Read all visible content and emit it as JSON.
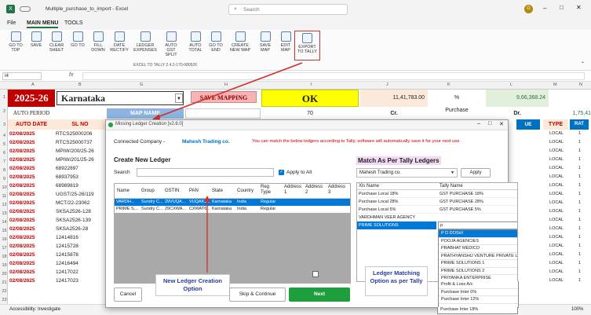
{
  "window": {
    "title": "Multiple_purchase_to_import",
    "app": "Excel",
    "search_placeholder": "Search",
    "user_initial": "G"
  },
  "ribbon_tabs": [
    "File",
    "MAIN MENU",
    "TOOLS"
  ],
  "ribbon_buttons": [
    "GO TO TOP",
    "SAVE",
    "CLEAR SHEET",
    "GO TO",
    "FILL DOWN",
    "DATE RECTIFY",
    "LEDGER EXPENSES",
    "AUTO GST SPLIT",
    "AUTO TOTAL",
    "GO TO END",
    "CREATE NEW MAP",
    "SAVE MAP",
    "EDIT MAP",
    "EXPORT TO TALLY"
  ],
  "ribbon_group_label": "EXCEL TO TALLY 2.4.2-170-080526",
  "name_box": "I4",
  "formula_fx": "fx",
  "columns": [
    "A",
    "B",
    "G",
    "H",
    "I",
    "J",
    "K",
    "L",
    "M",
    "N"
  ],
  "sheet": {
    "year": "2025-26",
    "state": "Karnataka",
    "save_mapping": "SAVE MAPPING",
    "status": "OK",
    "total1": "11,41,783.00",
    "percent": "%",
    "total2": "9,66,368.24",
    "auto_period": "AUTO PERIOD",
    "map_name": "MAP NAME",
    "seventy": "70",
    "cr": "Cr.",
    "purchase": "Purchase",
    "dr": "Dr.",
    "dr_total": "1,75,41",
    "hdr_date": "AUTO DATE",
    "hdr_slno": "SL NO",
    "hdr_type": "TYPE",
    "hdr_rate": "RAT",
    "hdr_value": "UE",
    "rows": [
      {
        "date": "02/08/2025",
        "sl": "RTCS25000206"
      },
      {
        "date": "02/08/2025",
        "sl": "RTCS25000737"
      },
      {
        "date": "02/08/2025",
        "sl": "MPIW/200/25-26"
      },
      {
        "date": "02/08/2025",
        "sl": "MPIW/201/25-26"
      },
      {
        "date": "02/08/2025",
        "sl": "68922897"
      },
      {
        "date": "02/08/2025",
        "sl": "68937953"
      },
      {
        "date": "02/08/2025",
        "sl": "68989819"
      },
      {
        "date": "02/08/2025",
        "sl": "UGST/25-26/119"
      },
      {
        "date": "02/08/2025",
        "sl": "MCT/22-23062"
      },
      {
        "date": "02/08/2025",
        "sl": "SKSA2526-128"
      },
      {
        "date": "02/08/2025",
        "sl": "SKSA2526-139"
      },
      {
        "date": "02/08/2025",
        "sl": "SKSA2526-28"
      },
      {
        "date": "02/08/2025",
        "sl": "12414816"
      },
      {
        "date": "02/08/2025",
        "sl": "12415728"
      },
      {
        "date": "02/08/2025",
        "sl": "12415878"
      },
      {
        "date": "02/08/2025",
        "sl": "12416494"
      },
      {
        "date": "02/08/2025",
        "sl": "12417022"
      },
      {
        "date": "02/08/2025",
        "sl": "12417023"
      }
    ],
    "local": "LOCAL",
    "one": "1"
  },
  "row_numbers": [
    "1",
    "2",
    "3",
    "4",
    "5",
    "6",
    "7",
    "8",
    "9",
    "10",
    "11",
    "12",
    "13",
    "14",
    "15",
    "16",
    "17",
    "18",
    "19",
    "20",
    "21",
    "22",
    "23"
  ],
  "dialog": {
    "title": "Missing Ledger Creation [v2.6.0]",
    "company_label": "Connected Company -",
    "company": "Mahesh Trading co.",
    "notice": "You can match the below ledgers according to Tally, software will automatically save it for your next use.",
    "create_title": "Create New Ledger",
    "search_label": "Search",
    "apply_all": "Apply to All",
    "grid_headers": [
      "Name",
      "Group",
      "GSTIN",
      "PAN",
      "State",
      "Country",
      "Reg Type",
      "Address 1",
      "Address 2",
      "Address 3"
    ],
    "grid_rows": [
      [
        "VARDH...",
        "Sundry C...",
        "29VUQA...",
        "VUQAK1...",
        "Karnataka",
        "India",
        "Regular"
      ],
      [
        "PRIME S...",
        "Sundry C...",
        "29CXWA...",
        "CXWAT6...",
        "Karnataka",
        "India",
        "Regular"
      ]
    ],
    "cancel": "Cancel",
    "skip": "Skip & Continue",
    "next": "Next",
    "match_title": "Match As Per Tally Ledgers",
    "match_company": "Mahesh Trading co.",
    "apply": "Apply",
    "xls_header": "Xls Name",
    "tally_header": "Tally Name",
    "match_rows": [
      {
        "xls": "Purchase Local 18%",
        "tally": "GST PURCHASE 18%"
      },
      {
        "xls": "Purchase Local 28%",
        "tally": "GST PURCHASE 28%"
      },
      {
        "xls": "Purchase Local 5%",
        "tally": "GST PURCHASE 5%"
      },
      {
        "xls": "VARDHMAN VEER AGENCY",
        "tally": ""
      },
      {
        "xls": "PRIME SOLUTIONS",
        "tally": "p"
      }
    ],
    "dropdown": [
      "P D DOSHI",
      "POOJA AGENCIES",
      "PRABHAT MEDICO",
      "PRATHYANSHU VENTURE PRIVATE LI",
      "PRIME SOLUTIONS 1",
      "PRIME SOLUTIONS 2",
      "PRIYANKA ENTERPRISE",
      "Profit & Loss A/c",
      "Purchase Inter 0%",
      "Purchase Inter 12%",
      "Purchase Inter 18%",
      "Purchase Inter 28%"
    ]
  },
  "callouts": {
    "new_ledger": "New Ledger Creation Option",
    "ledger_matching": "Ledger Matching Option as per Tally"
  },
  "status": {
    "accessibility": "Accessibility: Investigate",
    "zoom": "100%"
  },
  "colors": {
    "excel_green": "#217346",
    "sheet_header": "#c00000",
    "yellow": "#ffff00",
    "blue": "#8db4e2",
    "next_green": "#1e9e3c",
    "red_arrow": "#d0312d",
    "selected_blue": "#0078d7"
  }
}
